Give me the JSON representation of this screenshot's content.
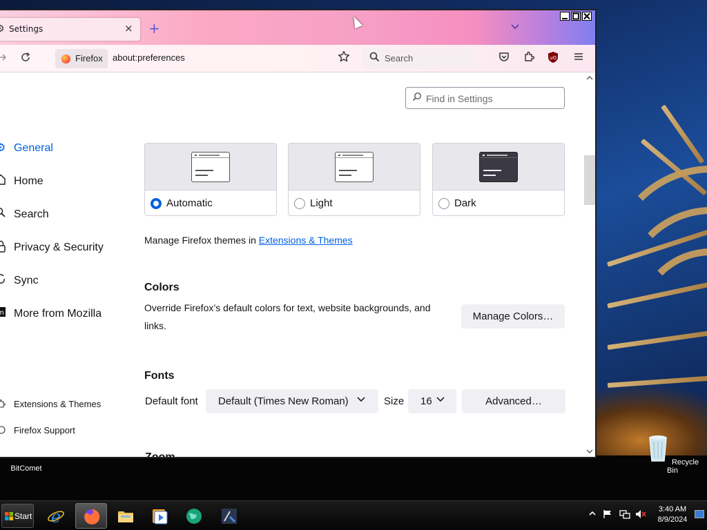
{
  "browser": {
    "tab": {
      "title": "Settings",
      "close_glyph": "×"
    },
    "new_tab_glyph": "+",
    "list_tabs_glyph": "⌵",
    "window_controls": {
      "minimize": "_",
      "maximize": "□",
      "close": "×"
    },
    "nav": {
      "back_glyph": "→",
      "reload_glyph": "⟳"
    },
    "urlbar": {
      "identity_label": "Firefox",
      "url": "about:preferences"
    },
    "search": {
      "placeholder": "Search"
    },
    "toolbar_icons": [
      "pocket-icon",
      "extensions-icon",
      "ublock-icon",
      "menu-icon"
    ]
  },
  "settings": {
    "find": {
      "placeholder": "Find in Settings"
    },
    "categories": [
      {
        "label": "General",
        "icon": "gear-icon",
        "active": true
      },
      {
        "label": "Home",
        "icon": "home-icon"
      },
      {
        "label": "Search",
        "icon": "search-icon"
      },
      {
        "label": "Privacy & Security",
        "icon": "lock-icon"
      },
      {
        "label": "Sync",
        "icon": "sync-icon"
      },
      {
        "label": "More from Mozilla",
        "icon": "mozilla-icon"
      }
    ],
    "footer_links": [
      {
        "label": "Extensions & Themes",
        "icon": "puzzle-icon"
      },
      {
        "label": "Firefox Support",
        "icon": "help-icon"
      }
    ],
    "appearance": {
      "options": [
        {
          "label": "Automatic",
          "selected": true
        },
        {
          "label": "Light",
          "selected": false
        },
        {
          "label": "Dark",
          "selected": false
        }
      ],
      "manage_text": "Manage Firefox themes in",
      "manage_link": "Extensions & Themes"
    },
    "colors": {
      "heading": "Colors",
      "description": "Override Firefox’s default colors for text, website backgrounds, and links.",
      "button": "Manage Colors…"
    },
    "fonts": {
      "heading": "Fonts",
      "default_font_label": "Default font",
      "default_font_value": "Default (Times New Roman)",
      "size_label": "Size",
      "size_value": "16",
      "advanced_button": "Advanced…"
    },
    "zoom": {
      "heading": "Zoom"
    }
  },
  "desktop": {
    "icons": [
      {
        "label": "BitComet",
        "icon": "bitcomet-icon"
      },
      {
        "label": "Recycle Bin",
        "icon": "recycle-bin-icon"
      }
    ]
  },
  "taskbar": {
    "start_label": "Start",
    "apps": [
      "internet-explorer-icon",
      "firefox-icon",
      "file-explorer-icon",
      "media-player-icon",
      "browser-globe-icon",
      "system-tool-icon"
    ],
    "clock": {
      "time": "3:40 AM",
      "date": "8/9/2024"
    }
  },
  "colors": {
    "accent": "#0061e0",
    "text": "#15141a",
    "button_bg": "#f0f0f4"
  }
}
